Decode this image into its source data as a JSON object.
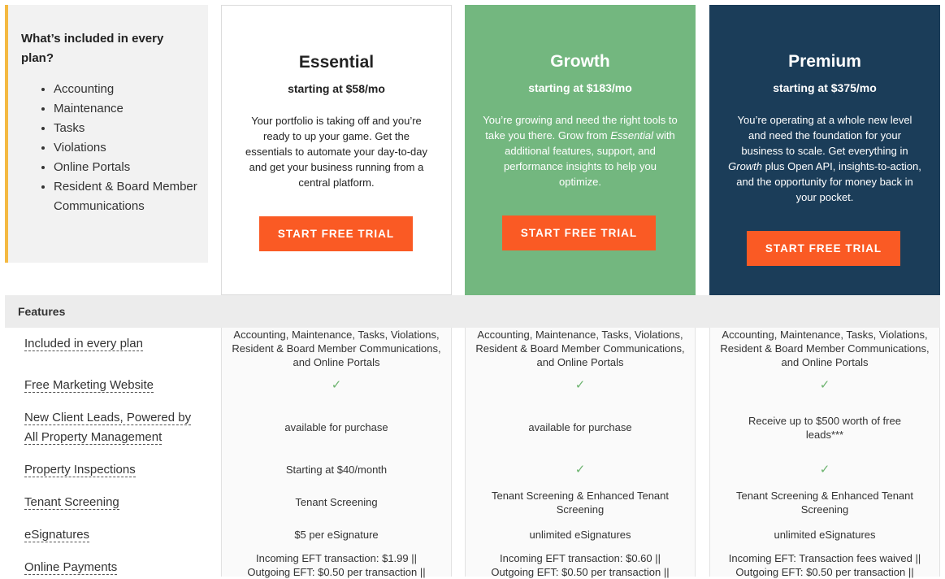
{
  "included": {
    "title": "What’s included in every plan?",
    "items": [
      "Accounting",
      "Maintenance",
      "Tasks",
      "Violations",
      "Online Portals",
      "Resident & Board Member Communications"
    ]
  },
  "plans": [
    {
      "name": "Essential",
      "price": "starting at $58/mo",
      "description": "Your portfolio is taking off and you’re ready to up your game. Get the essentials to automate your day-to-day and get your business running from a central platform.",
      "cta": "START FREE TRIAL"
    },
    {
      "name": "Growth",
      "price": "starting at $183/mo",
      "description_pre": "You’re growing and need the right tools to take you there. Grow from ",
      "description_em": "Essential",
      "description_post": " with additional features, support, and performance insights to help you optimize.",
      "cta": "START FREE TRIAL"
    },
    {
      "name": "Premium",
      "price": "starting at $375/mo",
      "description_pre": "You’re operating at a whole new level and need the foundation for your business to scale. Get everything in ",
      "description_em": "Growth",
      "description_post": " plus Open API, insights-to-action, and the opportunity for money back in your pocket.",
      "cta": "START FREE TRIAL"
    }
  ],
  "colors": {
    "accent": "#fa5a24",
    "growth": "#73b77f",
    "premium": "#1b3d59",
    "check": "#6cb36e",
    "bar": "#f4b942"
  },
  "features": {
    "header": "Features",
    "rows": [
      {
        "label": "Included in every plan",
        "values": [
          "Accounting, Maintenance, Tasks, Violations, Resident & Board Member Communications, and Online Portals",
          "Accounting, Maintenance, Tasks, Violations, Resident & Board Member Communications, and Online Portals",
          "Accounting, Maintenance, Tasks, Violations, Resident & Board Member Communications, and Online Portals"
        ]
      },
      {
        "label": "Free Marketing Website",
        "values": [
          "✓",
          "✓",
          "✓"
        ]
      },
      {
        "label": "New Client Leads, Powered by All Property Management",
        "values": [
          "available for purchase",
          "available for purchase",
          "Receive up to $500 worth of free leads***"
        ]
      },
      {
        "label": "Property Inspections",
        "values": [
          "Starting at $40/month",
          "✓",
          "✓"
        ]
      },
      {
        "label": "Tenant Screening",
        "values": [
          "Tenant Screening",
          "Tenant Screening & Enhanced Tenant Screening",
          "Tenant Screening & Enhanced Tenant Screening"
        ]
      },
      {
        "label": "eSignatures",
        "values": [
          "$5 per eSignature",
          "unlimited eSignatures",
          "unlimited eSignatures"
        ]
      },
      {
        "label": "Online Payments",
        "values": [
          "Incoming EFT transaction: $1.99 || Outgoing EFT: $0.50 per transaction ||",
          "Incoming EFT transaction: $0.60 || Outgoing EFT: $0.50 per transaction ||",
          "Incoming EFT: Transaction fees waived || Outgoing EFT: $0.50 per transaction ||"
        ]
      }
    ]
  }
}
